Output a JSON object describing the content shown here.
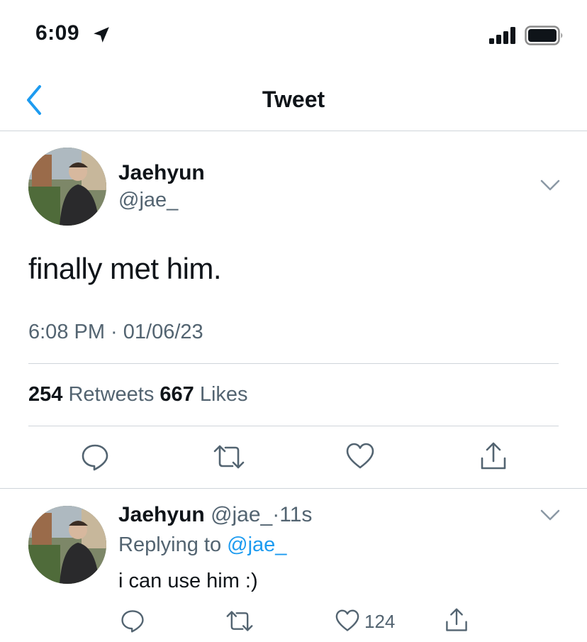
{
  "status_bar": {
    "time": "6:09",
    "icons": [
      "location-arrow-icon",
      "cellular-signal-icon",
      "battery-icon"
    ]
  },
  "nav": {
    "title": "Tweet",
    "back_icon": "chevron-left-icon",
    "accent_color": "#1d9bf0"
  },
  "tweet": {
    "display_name": "Jaehyun",
    "handle": "@jae_",
    "text": "finally met him.",
    "timestamp": "6:08 PM · 01/06/23",
    "retweets_count": "254",
    "retweets_label": "Retweets",
    "likes_count": "667",
    "likes_label": "Likes",
    "actions": [
      "reply-icon",
      "retweet-icon",
      "like-icon",
      "share-icon"
    ]
  },
  "reply": {
    "display_name": "Jaehyun",
    "handle": "@jae_",
    "separator": "·",
    "time": "11s",
    "replying_prefix": "Replying to",
    "replying_to": "@jae_",
    "text": "i can use him :)",
    "like_count": "124",
    "actions": [
      "reply-icon",
      "retweet-icon",
      "like-icon",
      "share-icon"
    ]
  }
}
